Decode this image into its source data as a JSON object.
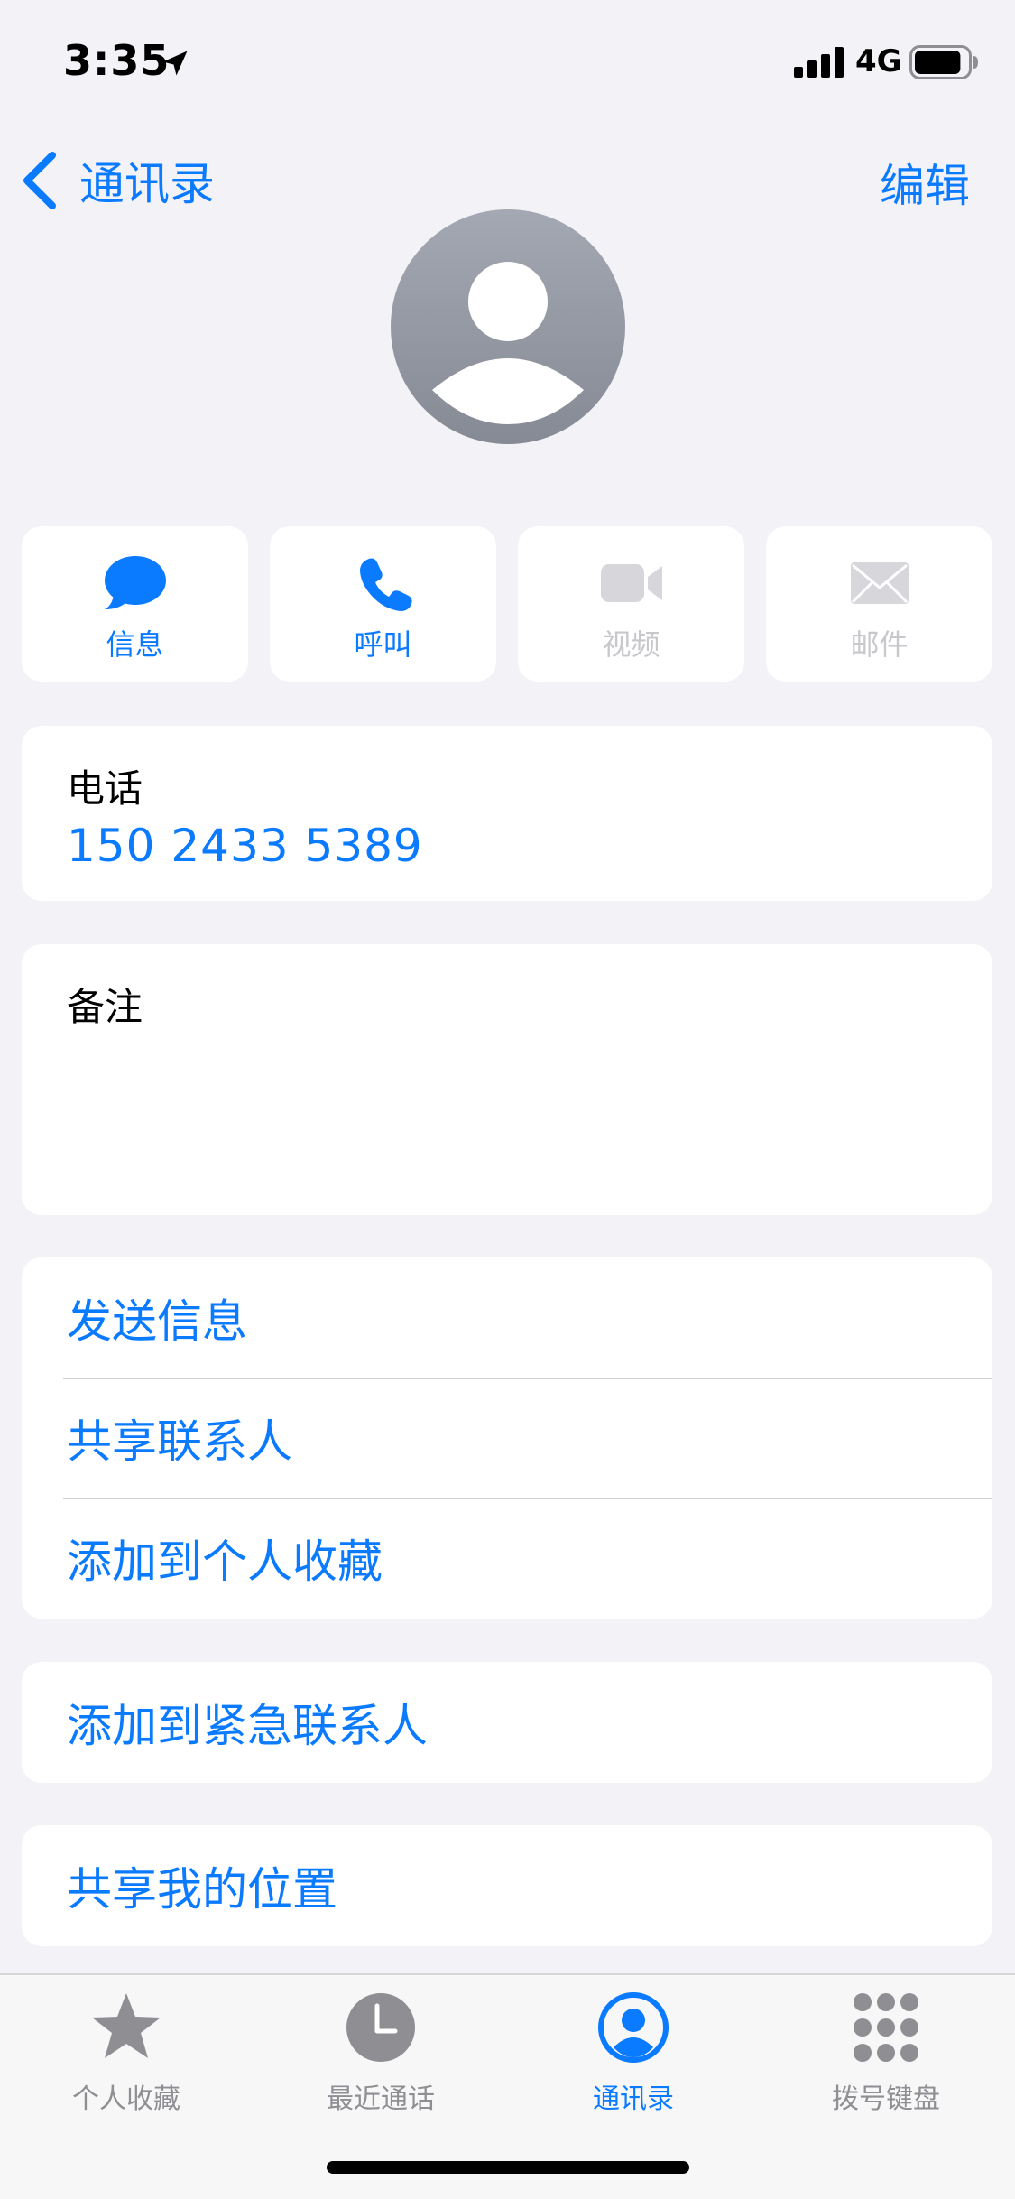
{
  "status_bar": {
    "time": "3:35",
    "network": "4G",
    "battery_level": 0.9
  },
  "nav": {
    "back_label": "通讯录",
    "edit_label": "编辑"
  },
  "actions": [
    {
      "label": "信息",
      "icon": "message-bubble-icon",
      "enabled": true
    },
    {
      "label": "呼叫",
      "icon": "phone-icon",
      "enabled": true
    },
    {
      "label": "视频",
      "icon": "video-icon",
      "enabled": false
    },
    {
      "label": "邮件",
      "icon": "mail-icon",
      "enabled": false
    }
  ],
  "phone": {
    "label": "电话",
    "number": "150 2433 5389"
  },
  "notes": {
    "label": "备注",
    "value": ""
  },
  "list_actions": [
    "发送信息",
    "共享联系人",
    "添加到个人收藏"
  ],
  "emergency": "添加到紧急联系人",
  "share_location": "共享我的位置",
  "tabs": [
    {
      "label": "个人收藏",
      "icon": "star-icon",
      "active": false
    },
    {
      "label": "最近通话",
      "icon": "clock-icon",
      "active": false
    },
    {
      "label": "通讯录",
      "icon": "contact-icon",
      "active": true
    },
    {
      "label": "拨号键盘",
      "icon": "keypad-icon",
      "active": false
    }
  ],
  "colors": {
    "accent": "#0a7aff",
    "background": "#f2f2f7",
    "disabled": "#c7c7cc",
    "inactive_tab": "#8e8e93"
  }
}
